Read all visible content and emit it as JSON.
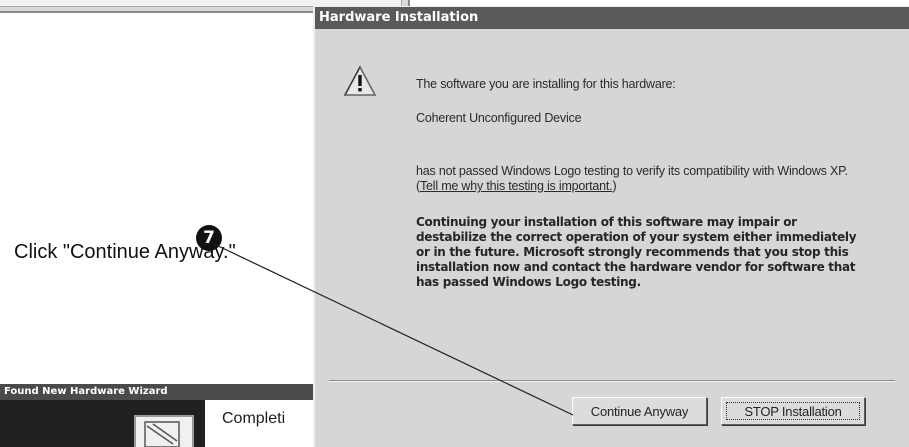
{
  "dialog": {
    "title": "Hardware Installation",
    "icon": "warning-icon",
    "line1": "The software you are installing for this hardware:",
    "device": "Coherent Unconfigured Device",
    "line3_before": "has not passed Windows Logo testing to verify its compatibility with Windows XP. (",
    "link": "Tell me why this testing is important.",
    "line3_after": ")",
    "warning": "Continuing your installation of this software may impair or destabilize the correct operation of your system either immediately or in the future. Microsoft strongly recommends that you stop this installation now and contact the hardware vendor for software that has passed Windows Logo testing.",
    "continue_label": "Continue Anyway",
    "stop_label": "STOP Installation"
  },
  "wizard": {
    "title": "Found New Hardware Wizard",
    "heading": "Completi",
    "icon": "hardware-wizard-icon"
  },
  "annotation": {
    "step": "7",
    "text": "Click \"Continue Anyway.\""
  }
}
